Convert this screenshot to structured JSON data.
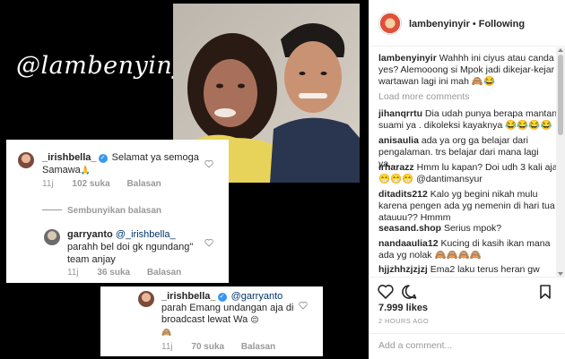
{
  "collage": {
    "watermark": "@lambenyinyir",
    "card1": {
      "comment": {
        "username": "_irishbella_",
        "text": "Selamat ya semoga Samawa",
        "emoji": "🙏",
        "time": "11j",
        "likes": "102 suka",
        "reply": "Balasan"
      },
      "hide_replies": "Sembunyikan balasan",
      "reply_comment": {
        "username": "garryanto",
        "mention": "@_irishbella_",
        "text": "parahh bel doi gk ngundang\" team anjay",
        "time": "11j",
        "likes": "36 suka",
        "reply": "Balasan"
      }
    },
    "card2": {
      "username": "_irishbella_",
      "mention": "@garryanto",
      "text": "parah Emang undangan aja di broadcast lewat Wa",
      "emoji1": "😌",
      "emoji2": "🙈",
      "time": "11j",
      "likes": "70 suka",
      "reply": "Balasan"
    }
  },
  "panel": {
    "username": "lambenyinyir",
    "dot": "•",
    "following": "Following",
    "caption": {
      "username": "lambenyinyir",
      "text": "Wahhh ini ciyus atau canda yes? Alemooong si Mpok jadi dikejar-kejar wartawan lagi ini mah 🙈😂"
    },
    "load_more": "Load more comments",
    "comments": [
      {
        "username": "jihanqrrtu",
        "text": "Dia udah punya berapa mantan suami ya . dikoleksi kayaknya 😂😂😂😂"
      },
      {
        "username": "anisaulia",
        "text": "ada ya org ga belajar dari pengalaman. trs belajar dari mana lagi ya...."
      },
      {
        "username": "irharazz",
        "text": "Hmm lu kapan? Doi udh 3 kali aja 😁😁😁 @dantimansyur"
      },
      {
        "username": "ditadits212",
        "text": "Kalo yg begini nikah mulu karena pengen ada yg nemenin di hari tua atauuu?? Hmmm"
      },
      {
        "username": "seasand.shop",
        "text": "Serius mpok?"
      },
      {
        "username": "nandaaulia12",
        "text": "Kucing di kasih ikan mana ada yg nolak 🙈🙈🙈🙈"
      },
      {
        "username": "hjjzhhzjzjzj",
        "text": "Ema2 laku terus heran gw"
      }
    ],
    "likes": "7.999 likes",
    "time_ago": "2 HOURS AGO",
    "add_comment_placeholder": "Add a comment..."
  },
  "colors": {
    "mention": "#003569",
    "meta_gray": "#999999",
    "verified_blue": "#3897f0"
  },
  "icons": [
    "heart-icon",
    "comment-icon",
    "bookmark-icon",
    "verified-icon",
    "more-options-icon"
  ]
}
